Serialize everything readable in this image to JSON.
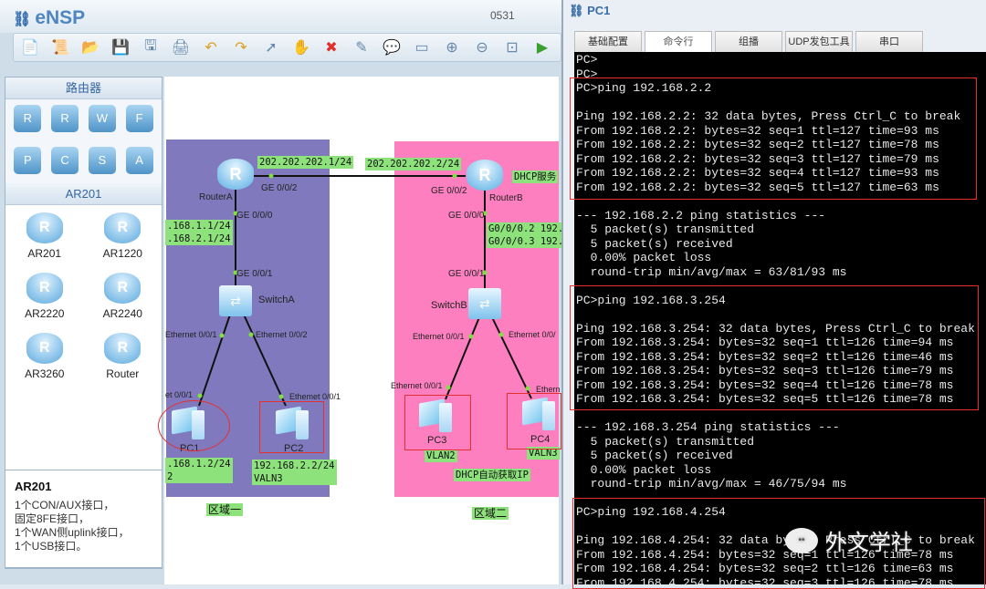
{
  "ensp": {
    "app_title": "eNSP",
    "project": "0531",
    "toolbar": [
      "new-topology",
      "new-script",
      "open",
      "save",
      "save-as",
      "print",
      "undo",
      "redo",
      "select",
      "pan",
      "delete",
      "delete-link",
      "text",
      "palette",
      "zoom-in",
      "zoom-out",
      "fit",
      "start"
    ],
    "category_header": "路由器",
    "category_icons": [
      "router",
      "router-series",
      "wireless",
      "firewall",
      "pc",
      "cloud",
      "switch",
      "auto"
    ],
    "device_header": "AR201",
    "devices": [
      "AR201",
      "AR1220",
      "AR2220",
      "AR2240",
      "AR3260",
      "Router"
    ],
    "info": {
      "title": "AR201",
      "lines": [
        "1个CON/AUX接口，",
        "固定8FE接口，",
        "1个WAN侧uplink接口，",
        "1个USB接口。"
      ]
    }
  },
  "topology": {
    "zone1_color": "#8079bd",
    "zone2_color": "#fd7fc0",
    "routerA": "RouterA",
    "routerB": "RouterB",
    "switchA": "SwitchA",
    "switchB": "SwitchB",
    "pcs": [
      "PC1",
      "PC2",
      "PC3",
      "PC4"
    ],
    "ports": {
      "ra_ge002": "GE 0/0/2",
      "rb_ge002": "GE 0/0/2",
      "ra_ge000": "GE 0/0/0",
      "rb_ge000": "GE 0/0/0",
      "sa_ge001": "GE 0/0/1",
      "sb_ge001": "GE 0/0/1",
      "sa_e1": "Ethernet 0/0/1",
      "sa_e2": "Ethernet 0/0/2",
      "sb_e1": "Ethernet 0/0/1",
      "sb_e2": "Ethernet 0/0/",
      "pc1_e": "et 0/0/1",
      "pc2_e": "Ethemet 0/0/1",
      "pc3_e": "Ethernet 0/0/1",
      "pc4_e": "Ethern"
    },
    "notes": {
      "ra_wan": "202.202.202.1/24",
      "rb_wan": "202.202.202.2/24",
      "dhcp": "DHCP服务",
      "ra_lan": ".168.1.1/24\n.168.2.1/24",
      "rb_sub": "G0/0/0.2 192.\nG0/0/0.3 192.",
      "pc1": ".168.1.2/24\n2",
      "pc2": "192.168.2.2/24\nVALN3",
      "pc3": "VLAN2",
      "pc4": "VALN3",
      "dhcp_auto": "DHCP自动获取IP",
      "zone1": "区域一",
      "zone2": "区域二"
    }
  },
  "pc_window": {
    "title": "PC1",
    "tabs": [
      "基础配置",
      "命令行",
      "组播",
      "UDP发包工具",
      "串口"
    ],
    "active_tab": 1,
    "terminal": [
      "PC>",
      "PC>",
      "PC>ping 192.168.2.2",
      "",
      "Ping 192.168.2.2: 32 data bytes, Press Ctrl_C to break",
      "From 192.168.2.2: bytes=32 seq=1 ttl=127 time=93 ms",
      "From 192.168.2.2: bytes=32 seq=2 ttl=127 time=78 ms",
      "From 192.168.2.2: bytes=32 seq=3 ttl=127 time=79 ms",
      "From 192.168.2.2: bytes=32 seq=4 ttl=127 time=93 ms",
      "From 192.168.2.2: bytes=32 seq=5 ttl=127 time=63 ms",
      "",
      "--- 192.168.2.2 ping statistics ---",
      "  5 packet(s) transmitted",
      "  5 packet(s) received",
      "  0.00% packet loss",
      "  round-trip min/avg/max = 63/81/93 ms",
      "",
      "PC>ping 192.168.3.254",
      "",
      "Ping 192.168.3.254: 32 data bytes, Press Ctrl_C to break",
      "From 192.168.3.254: bytes=32 seq=1 ttl=126 time=94 ms",
      "From 192.168.3.254: bytes=32 seq=2 ttl=126 time=46 ms",
      "From 192.168.3.254: bytes=32 seq=3 ttl=126 time=79 ms",
      "From 192.168.3.254: bytes=32 seq=4 ttl=126 time=78 ms",
      "From 192.168.3.254: bytes=32 seq=5 ttl=126 time=78 ms",
      "",
      "--- 192.168.3.254 ping statistics ---",
      "  5 packet(s) transmitted",
      "  5 packet(s) received",
      "  0.00% packet loss",
      "  round-trip min/avg/max = 46/75/94 ms",
      "",
      "PC>ping 192.168.4.254",
      "",
      "Ping 192.168.4.254: 32 data bytes, Press Ctrl_C to break",
      "From 192.168.4.254: bytes=32 seq=1 ttl=126 time=78 ms",
      "From 192.168.4.254: bytes=32 seq=2 ttl=126 time=63 ms",
      "From 192.168.4.254: bytes=32 seq=3 ttl=126 time=78 ms"
    ]
  },
  "watermark": "外文学社"
}
